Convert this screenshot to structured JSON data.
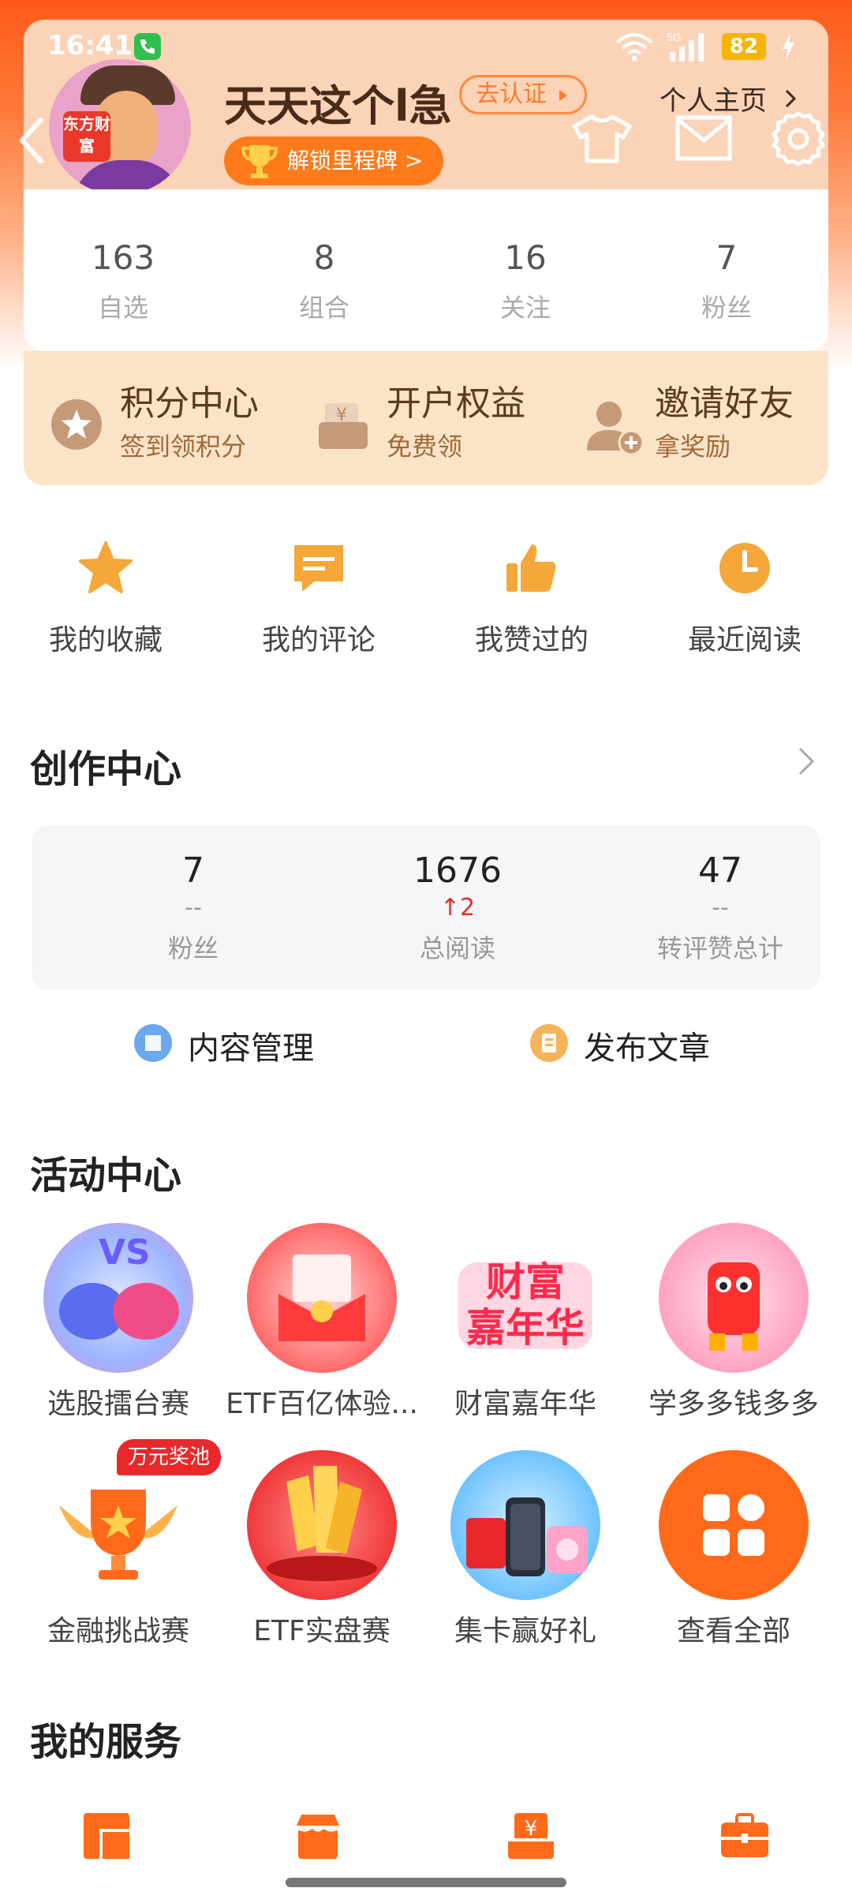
{
  "status_bar": {
    "time": "16:41",
    "battery": "82",
    "network": "5G"
  },
  "profile": {
    "avatar_badge": "东方财富",
    "username": "天天这个l急",
    "verify_label": "去认证",
    "milestone_label": "解锁里程碑 >",
    "home_link": "个人主页"
  },
  "stats": [
    {
      "num": "163",
      "label": "自选"
    },
    {
      "num": "8",
      "label": "组合"
    },
    {
      "num": "16",
      "label": "关注"
    },
    {
      "num": "7",
      "label": "粉丝"
    }
  ],
  "perks": [
    {
      "title": "积分中心",
      "sub": "签到领积分",
      "icon": "star-coin-icon"
    },
    {
      "title": "开户权益",
      "sub": "免费领",
      "icon": "yen-box-icon"
    },
    {
      "title": "邀请好友",
      "sub": "拿奖励",
      "icon": "invite-user-icon"
    }
  ],
  "quick_links": [
    {
      "label": "我的收藏",
      "icon": "star-icon"
    },
    {
      "label": "我的评论",
      "icon": "comment-icon"
    },
    {
      "label": "我赞过的",
      "icon": "thumbs-up-icon"
    },
    {
      "label": "最近阅读",
      "icon": "clock-icon"
    }
  ],
  "creator": {
    "title": "创作中心",
    "stats": [
      {
        "num": "7",
        "delta": "--",
        "label": "粉丝"
      },
      {
        "num": "1676",
        "delta": "2",
        "label": "总阅读"
      },
      {
        "num": "47",
        "delta": "--",
        "label": "转评赞总计"
      }
    ],
    "actions": [
      {
        "label": "内容管理",
        "color": "#6aa8ef"
      },
      {
        "label": "发布文章",
        "color": "#f5b45a"
      }
    ]
  },
  "activities": {
    "title": "活动中心",
    "prize_badge": "万元奖池",
    "carnival_text": "财富嘉年华",
    "items": [
      {
        "label": "选股擂台赛"
      },
      {
        "label": "ETF百亿体验..."
      },
      {
        "label": "财富嘉年华"
      },
      {
        "label": "学多多钱多多"
      },
      {
        "label": "金融挑战赛"
      },
      {
        "label": "ETF实盘赛"
      },
      {
        "label": "集卡赢好礼"
      },
      {
        "label": "查看全部"
      }
    ]
  },
  "services": {
    "title": "我的服务"
  },
  "colors": {
    "accent": "#ff7a1a",
    "brand_red": "#e8382a"
  }
}
